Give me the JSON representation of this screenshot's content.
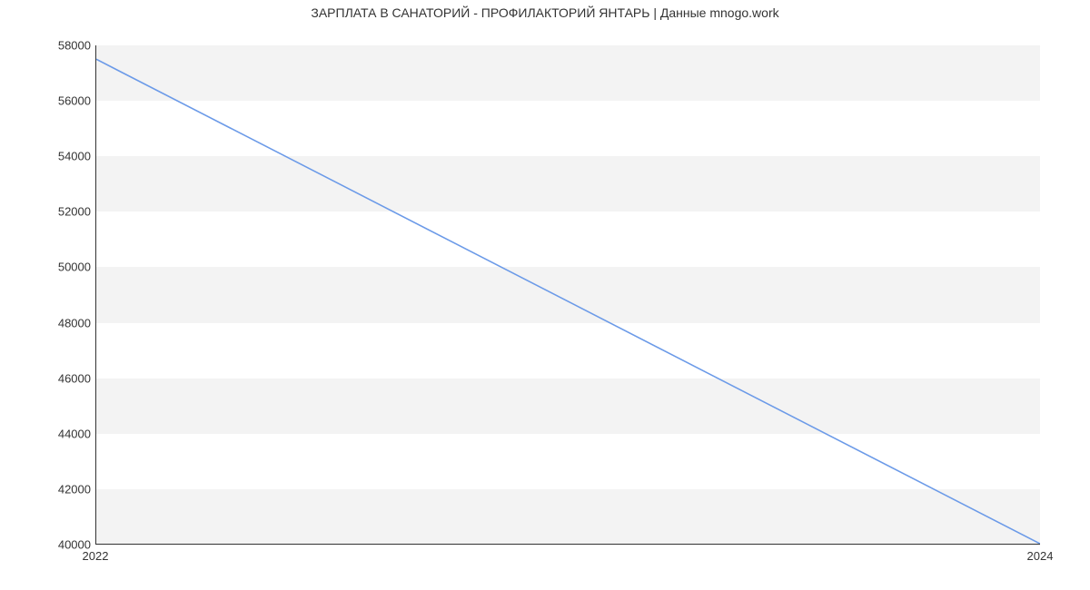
{
  "chart_data": {
    "type": "line",
    "title": "ЗАРПЛАТА В САНАТОРИЙ - ПРОФИЛАКТОРИЙ ЯНТАРЬ | Данные mnogo.work",
    "xlabel": "",
    "ylabel": "",
    "x": [
      2022,
      2024
    ],
    "values": [
      57500,
      40000
    ],
    "ylim": [
      40000,
      58000
    ],
    "xlim": [
      2022,
      2024
    ],
    "y_ticks": [
      40000,
      42000,
      44000,
      46000,
      48000,
      50000,
      52000,
      54000,
      56000,
      58000
    ],
    "x_ticks": [
      2022,
      2024
    ],
    "line_color": "#6b9ae8",
    "bands": [
      {
        "from": 40000,
        "to": 42000
      },
      {
        "from": 44000,
        "to": 46000
      },
      {
        "from": 48000,
        "to": 50000
      },
      {
        "from": 52000,
        "to": 54000
      },
      {
        "from": 56000,
        "to": 58000
      }
    ]
  }
}
